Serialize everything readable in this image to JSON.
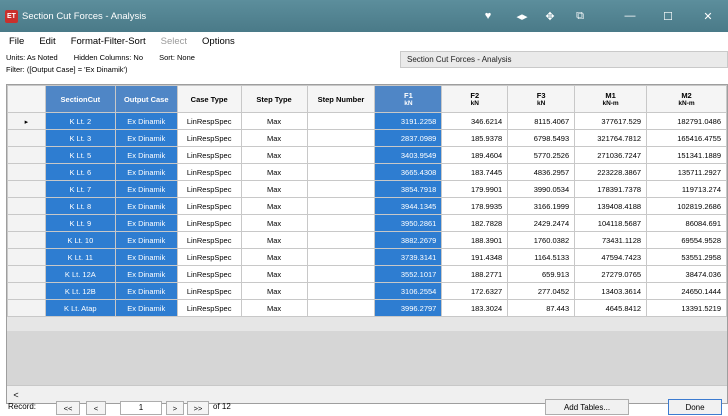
{
  "window": {
    "badge": "ET",
    "title": "Section Cut Forces - Analysis",
    "icons": [
      "heart-icon",
      "arrows-icon",
      "pin-icon",
      "restore-icon",
      "minimize-icon",
      "maximize-icon",
      "close-icon"
    ],
    "icon_glyphs": [
      "♥",
      "◂▸",
      "✥",
      "⧉",
      "—",
      "☐",
      "✕"
    ]
  },
  "menu": [
    "File",
    "Edit",
    "Format-Filter-Sort",
    "Select",
    "Options"
  ],
  "info": {
    "units": "Units: As Noted",
    "hidden": "Hidden Columns: No",
    "sort": "Sort: None",
    "filter": "Filter: ([Output Case] = 'Ex Dinamik')",
    "caption": "Section Cut Forces - Analysis"
  },
  "columns": [
    {
      "name": "SectionCut",
      "unit": ""
    },
    {
      "name": "Output Case",
      "unit": ""
    },
    {
      "name": "Case Type",
      "unit": ""
    },
    {
      "name": "Step Type",
      "unit": ""
    },
    {
      "name": "Step Number",
      "unit": ""
    },
    {
      "name": "F1",
      "unit": "kN"
    },
    {
      "name": "F2",
      "unit": "kN"
    },
    {
      "name": "F3",
      "unit": "kN"
    },
    {
      "name": "M1",
      "unit": "kN-m"
    },
    {
      "name": "M2",
      "unit": "kN-m"
    }
  ],
  "rows": [
    [
      "K Lt. 2",
      "Ex Dinamik",
      "LinRespSpec",
      "Max",
      "",
      "3191.2258",
      "346.6214",
      "8115.4067",
      "377617.529",
      "182791.0486"
    ],
    [
      "K Lt. 3",
      "Ex Dinamik",
      "LinRespSpec",
      "Max",
      "",
      "2837.0989",
      "185.9378",
      "6798.5493",
      "321764.7812",
      "165416.4755"
    ],
    [
      "K Lt. 5",
      "Ex Dinamik",
      "LinRespSpec",
      "Max",
      "",
      "3403.9549",
      "189.4604",
      "5770.2526",
      "271036.7247",
      "151341.1889"
    ],
    [
      "K Lt. 6",
      "Ex Dinamik",
      "LinRespSpec",
      "Max",
      "",
      "3665.4308",
      "183.7445",
      "4836.2957",
      "223228.3867",
      "135711.2927"
    ],
    [
      "K Lt. 7",
      "Ex Dinamik",
      "LinRespSpec",
      "Max",
      "",
      "3854.7918",
      "179.9901",
      "3990.0534",
      "178391.7378",
      "119713.274"
    ],
    [
      "K Lt. 8",
      "Ex Dinamik",
      "LinRespSpec",
      "Max",
      "",
      "3944.1345",
      "178.9935",
      "3166.1999",
      "139408.4188",
      "102819.2686"
    ],
    [
      "K Lt. 9",
      "Ex Dinamik",
      "LinRespSpec",
      "Max",
      "",
      "3950.2861",
      "182.7828",
      "2429.2474",
      "104118.5687",
      "86084.691"
    ],
    [
      "K Lt. 10",
      "Ex Dinamik",
      "LinRespSpec",
      "Max",
      "",
      "3882.2679",
      "188.3901",
      "1760.0382",
      "73431.1128",
      "69554.9528"
    ],
    [
      "K Lt. 11",
      "Ex Dinamik",
      "LinRespSpec",
      "Max",
      "",
      "3739.3141",
      "191.4348",
      "1164.5133",
      "47594.7423",
      "53551.2958"
    ],
    [
      "K Lt. 12A",
      "Ex Dinamik",
      "LinRespSpec",
      "Max",
      "",
      "3552.1017",
      "188.2771",
      "659.913",
      "27279.0765",
      "38474.036"
    ],
    [
      "K Lt. 12B",
      "Ex Dinamik",
      "LinRespSpec",
      "Max",
      "",
      "3106.2554",
      "172.6327",
      "277.0452",
      "13403.3614",
      "24650.1444"
    ],
    [
      "K Lt. Atap",
      "Ex Dinamik",
      "LinRespSpec",
      "Max",
      "",
      "3996.2797",
      "183.3024",
      "87.443",
      "4645.8412",
      "13391.5219"
    ]
  ],
  "row_marker": "▸",
  "scroll_left": "<",
  "footer": {
    "record_label": "Record:",
    "first": "<<",
    "prev": "<",
    "current": "1",
    "next": ">",
    "last": ">>",
    "of": "of 12",
    "add_tables": "Add Tables...",
    "done": "Done"
  },
  "colors": {
    "titlebar": "#4f8595",
    "selected_header": "#4f86c6",
    "selected_cell": "#2e7dd1"
  }
}
